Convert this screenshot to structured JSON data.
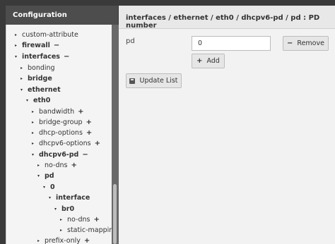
{
  "sidebar": {
    "title": "Configuration",
    "items": [
      {
        "label": "custom-attribute",
        "bold": false,
        "arrow": "▸",
        "suffix": ""
      },
      {
        "label": "firewall",
        "bold": true,
        "arrow": "▸",
        "suffix": "−"
      },
      {
        "label": "interfaces",
        "bold": true,
        "arrow": "▾",
        "suffix": "−"
      },
      {
        "label": "bonding",
        "bold": false,
        "arrow": "▸",
        "suffix": ""
      },
      {
        "label": "bridge",
        "bold": true,
        "arrow": "▸",
        "suffix": ""
      },
      {
        "label": "ethernet",
        "bold": true,
        "arrow": "▾",
        "suffix": ""
      },
      {
        "label": "eth0",
        "bold": true,
        "arrow": "▾",
        "suffix": ""
      },
      {
        "label": "bandwidth",
        "bold": false,
        "arrow": "▸",
        "suffix": "+"
      },
      {
        "label": "bridge-group",
        "bold": false,
        "arrow": "▸",
        "suffix": "+"
      },
      {
        "label": "dhcp-options",
        "bold": false,
        "arrow": "▸",
        "suffix": "+"
      },
      {
        "label": "dhcpv6-options",
        "bold": false,
        "arrow": "▸",
        "suffix": "+"
      },
      {
        "label": "dhcpv6-pd",
        "bold": true,
        "arrow": "▾",
        "suffix": "−"
      },
      {
        "label": "no-dns",
        "bold": false,
        "arrow": "▸",
        "suffix": "+"
      },
      {
        "label": "pd",
        "bold": true,
        "arrow": "▾",
        "suffix": ""
      },
      {
        "label": "0",
        "bold": true,
        "arrow": "▾",
        "suffix": ""
      },
      {
        "label": "interface",
        "bold": true,
        "arrow": "▾",
        "suffix": ""
      },
      {
        "label": "br0",
        "bold": true,
        "arrow": "▾",
        "suffix": ""
      },
      {
        "label": "no-dns",
        "bold": false,
        "arrow": "▸",
        "suffix": "+"
      },
      {
        "label": "static-mapping",
        "bold": false,
        "arrow": "▸",
        "suffix": ""
      },
      {
        "label": "prefix-only",
        "bold": false,
        "arrow": "▸",
        "suffix": "+"
      }
    ]
  },
  "main": {
    "breadcrumb": "interfaces / ethernet / eth0 / dhcpv6-pd / pd : PD number",
    "field_label": "pd",
    "field_value": "0",
    "remove_label": "Remove",
    "remove_icon": "−",
    "add_label": "Add",
    "add_icon": "+",
    "update_label": "Update List"
  }
}
